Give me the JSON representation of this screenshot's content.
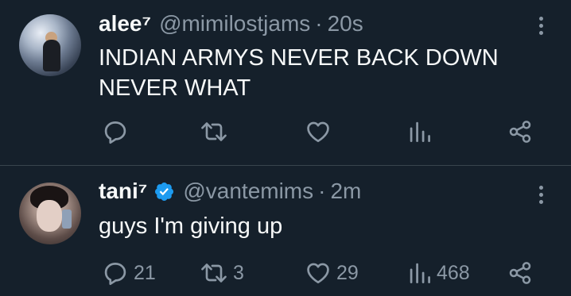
{
  "tweets": [
    {
      "display_name": "alee⁷",
      "handle": "@mimilostjams",
      "separator": "·",
      "time": "20s",
      "verified": false,
      "text_lines": [
        "INDIAN ARMYS NEVER BACK DOWN",
        "NEVER WHAT"
      ],
      "replies": "",
      "retweets": "",
      "likes": "",
      "views": ""
    },
    {
      "display_name": "tani⁷",
      "handle": "@vantemims",
      "separator": "·",
      "time": "2m",
      "verified": true,
      "text_lines": [
        "guys I'm giving up"
      ],
      "replies": "21",
      "retweets": "3",
      "likes": "29",
      "views": "468"
    }
  ],
  "icons": {
    "reply": "reply-icon",
    "retweet": "retweet-icon",
    "like": "heart-icon",
    "views": "views-icon",
    "share": "share-icon",
    "more": "more-options-icon",
    "verified": "verified-badge-icon"
  },
  "colors": {
    "background": "#15202b",
    "text": "#f7f9f9",
    "muted": "#8b98a5",
    "divider": "#38444d",
    "verified": "#1d9bf0"
  }
}
